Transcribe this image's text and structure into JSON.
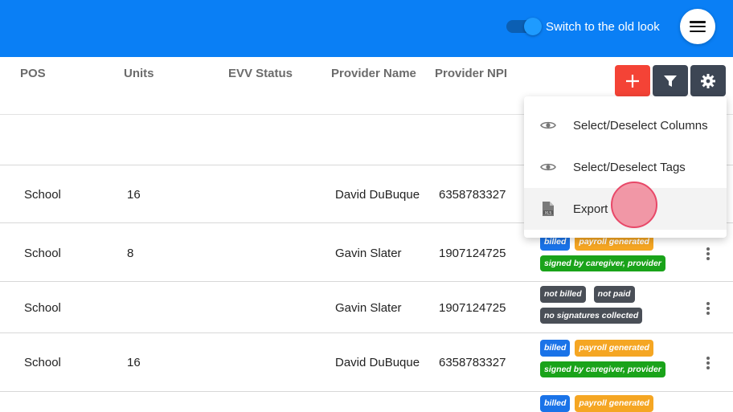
{
  "topbar": {
    "toggle_label": "Switch to the old look",
    "toggle_on": true,
    "brand_color": "#0a7ff5"
  },
  "table": {
    "columns": [
      "POS",
      "Units",
      "EVV Status",
      "Provider Name",
      "Provider NPI"
    ],
    "rows": [
      {
        "pos": "School",
        "units": "16",
        "provider_name": "David DuBuque",
        "provider_npi": "6358783327",
        "tags": []
      },
      {
        "pos": "School",
        "units": "8",
        "provider_name": "Gavin Slater",
        "provider_npi": "1907124725",
        "tags": [
          "billed",
          "payroll generated",
          "signed by caregiver, provider"
        ]
      },
      {
        "pos": "School",
        "units": "",
        "provider_name": "Gavin Slater",
        "provider_npi": "1907124725",
        "tags": [
          "not billed",
          "not paid",
          "no signatures collected"
        ]
      },
      {
        "pos": "School",
        "units": "16",
        "provider_name": "David DuBuque",
        "provider_npi": "6358783327",
        "tags": [
          "billed",
          "payroll generated",
          "signed by caregiver, provider"
        ]
      },
      {
        "pos": "",
        "units": "",
        "provider_name": "",
        "provider_npi": "",
        "tags": [
          "billed",
          "payroll generated"
        ]
      }
    ]
  },
  "toolbar": {
    "add_icon": "plus-icon",
    "filter_icon": "filter-icon",
    "settings_icon": "gear-icon"
  },
  "dropdown": {
    "items": [
      {
        "label": "Select/Deselect Columns",
        "icon": "eye-icon"
      },
      {
        "label": "Select/Deselect Tags",
        "icon": "eye-icon"
      },
      {
        "label": "Export",
        "icon": "xls-file-icon"
      }
    ]
  },
  "tag_colors": {
    "billed": "#1a73e8",
    "payroll generated": "#f5a623",
    "signed by caregiver, provider": "#1aa31a",
    "not billed": "#4a4f57",
    "not paid": "#4a4f57",
    "no signatures collected": "#4a4f57"
  }
}
